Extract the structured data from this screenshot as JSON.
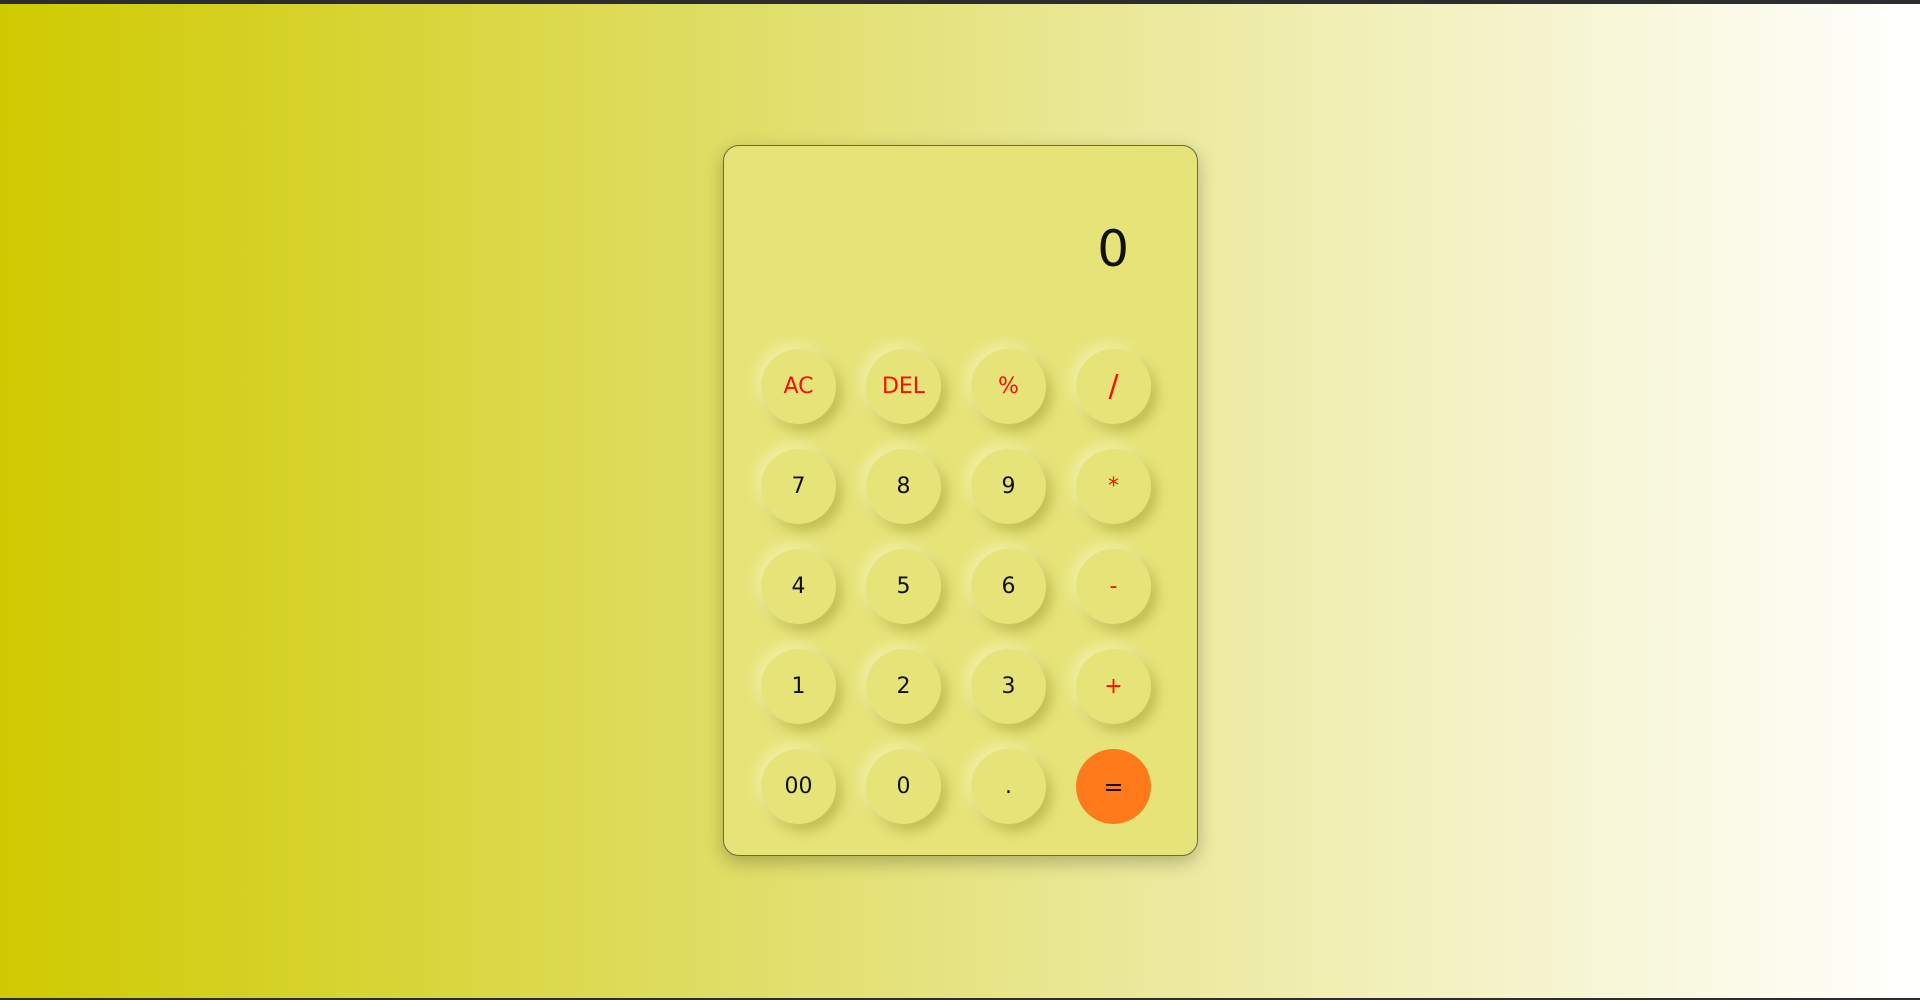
{
  "display": {
    "value": "0"
  },
  "keys": [
    {
      "label": "AC",
      "type": "op"
    },
    {
      "label": "DEL",
      "type": "op"
    },
    {
      "label": "%",
      "type": "op"
    },
    {
      "label": "/",
      "type": "op"
    },
    {
      "label": "7",
      "type": "num"
    },
    {
      "label": "8",
      "type": "num"
    },
    {
      "label": "9",
      "type": "num"
    },
    {
      "label": "*",
      "type": "op"
    },
    {
      "label": "4",
      "type": "num"
    },
    {
      "label": "5",
      "type": "num"
    },
    {
      "label": "6",
      "type": "num"
    },
    {
      "label": "-",
      "type": "op"
    },
    {
      "label": "1",
      "type": "num"
    },
    {
      "label": "2",
      "type": "num"
    },
    {
      "label": "3",
      "type": "num"
    },
    {
      "label": "+",
      "type": "op"
    },
    {
      "label": "00",
      "type": "num"
    },
    {
      "label": "0",
      "type": "num"
    },
    {
      "label": ".",
      "type": "num"
    },
    {
      "label": "=",
      "type": "equals"
    }
  ],
  "colors": {
    "operator_text": "#ff0a0a",
    "equals_background": "#ff7a1a",
    "calculator_body": "#e6e479"
  }
}
